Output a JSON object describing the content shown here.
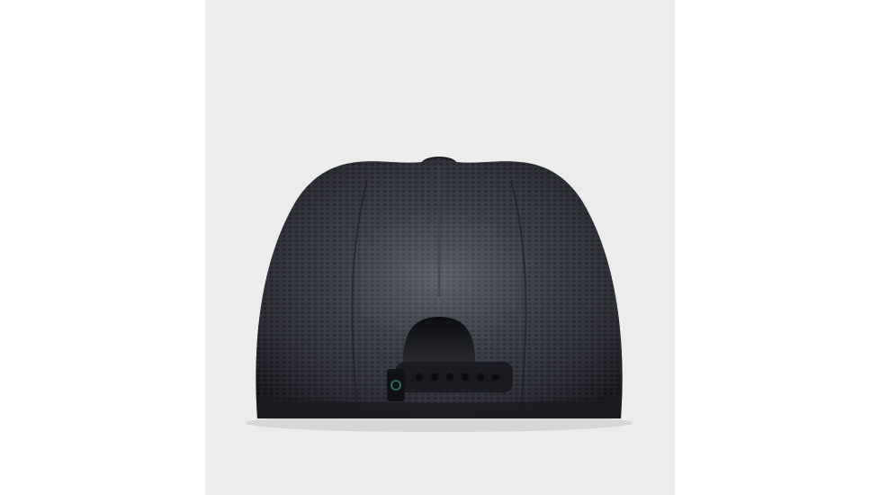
{
  "image": {
    "subject": "product-photo",
    "colors": {
      "page_background": "#ffffff",
      "panel_background": "#ececec",
      "mesh_dark": "#24262d",
      "mesh_light": "#5b5f68",
      "strap": "#1a1b20",
      "logo_patch": "#2b6b63"
    },
    "icons": [
      "cap-icon",
      "logo-patch-icon"
    ]
  }
}
